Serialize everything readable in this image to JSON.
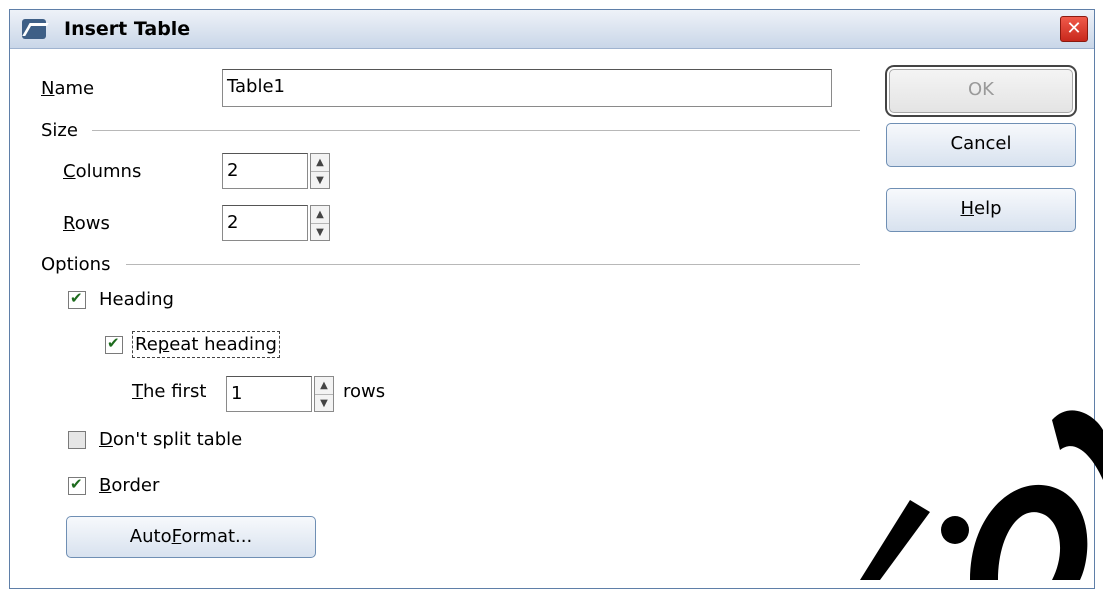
{
  "dialog": {
    "title": "Insert Table",
    "close_symbol": "✕"
  },
  "name_field": {
    "label_mnemonic": "N",
    "label_rest": "ame",
    "value": "Table1"
  },
  "size": {
    "header": "Size",
    "columns_label_mnemonic": "C",
    "columns_label_rest": "olumns",
    "columns_value": "2",
    "rows_label_mnemonic": "R",
    "rows_label_rest": "ows",
    "rows_value": "2"
  },
  "options": {
    "header": "Options",
    "heading_label": "Heading",
    "repeat_heading_pre": "Re",
    "repeat_heading_mnemonic": "p",
    "repeat_heading_post": "eat heading",
    "first_mnemonic": "T",
    "first_rest": "he first",
    "first_value": "1",
    "rows_suffix": "rows",
    "dont_split_mnemonic": "D",
    "dont_split_rest": "on't split table",
    "border_mnemonic": "B",
    "border_rest": "order",
    "heading_checked": true,
    "repeat_heading_checked": true,
    "dont_split_checked": false,
    "border_checked": true
  },
  "buttons": {
    "ok": "OK",
    "cancel": "Cancel",
    "help_mnemonic": "H",
    "help_rest": "elp",
    "autoformat_pre": "Auto",
    "autoformat_mnemonic": "F",
    "autoformat_post": "ormat..."
  },
  "spinner_up": "▲",
  "spinner_down": "▼",
  "colors": {
    "titlebar": "#c9d6e8",
    "close_button": "#d8372a",
    "check_mark": "#1d6b1d"
  }
}
